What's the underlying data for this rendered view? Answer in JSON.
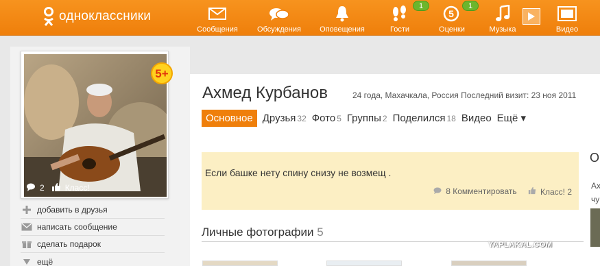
{
  "header": {
    "logo_text": "одноклассники",
    "nav": [
      {
        "label": "Сообщения",
        "icon": "envelope-icon"
      },
      {
        "label": "Обсуждения",
        "icon": "chat-bubbles-icon"
      },
      {
        "label": "Оповещения",
        "icon": "bell-icon"
      },
      {
        "label": "Гости",
        "icon": "footprints-icon",
        "badge": "1"
      },
      {
        "label": "Оценки",
        "icon": "rating-five-icon",
        "badge": "1"
      },
      {
        "label": "Музыка",
        "icon": "music-note-icon"
      },
      {
        "label": "Видео",
        "icon": "film-icon"
      }
    ]
  },
  "profile": {
    "rating_badge": "5+",
    "photo_comments": "2",
    "photo_like_label": "Класс!",
    "name": "Ахмед Курбанов",
    "meta": "24 года, Махачкала, Россия  Последний визит: 23 ноя 2011"
  },
  "actions": [
    {
      "label": "добавить в друзья",
      "icon": "plus-icon"
    },
    {
      "label": "написать сообщение",
      "icon": "envelope-icon"
    },
    {
      "label": "сделать подарок",
      "icon": "gift-icon"
    },
    {
      "label": "ещё",
      "icon": "triangle-down-icon"
    }
  ],
  "tabs": [
    {
      "label": "Основное",
      "count": "",
      "active": true
    },
    {
      "label": "Друзья",
      "count": "32"
    },
    {
      "label": "Фото",
      "count": "5"
    },
    {
      "label": "Группы",
      "count": "2"
    },
    {
      "label": "Поделился",
      "count": "18"
    },
    {
      "label": "Видео",
      "count": ""
    },
    {
      "label": "Ещё ▾",
      "count": ""
    }
  ],
  "status": {
    "text": "Если башке нету спину снизу не возмещ .",
    "comments": "8 Комментировать",
    "likes": "Класс! 2"
  },
  "photos_section": {
    "title": "Личные фотографии",
    "count": "5"
  },
  "right_column": {
    "letter": "О",
    "line1": "Ах",
    "line2": "чу"
  },
  "watermark": "YAPLAKAL.COM",
  "colors": {
    "accent": "#ef7f0b",
    "status_bg": "#fcefc4",
    "badge_green": "#6cb62d"
  }
}
